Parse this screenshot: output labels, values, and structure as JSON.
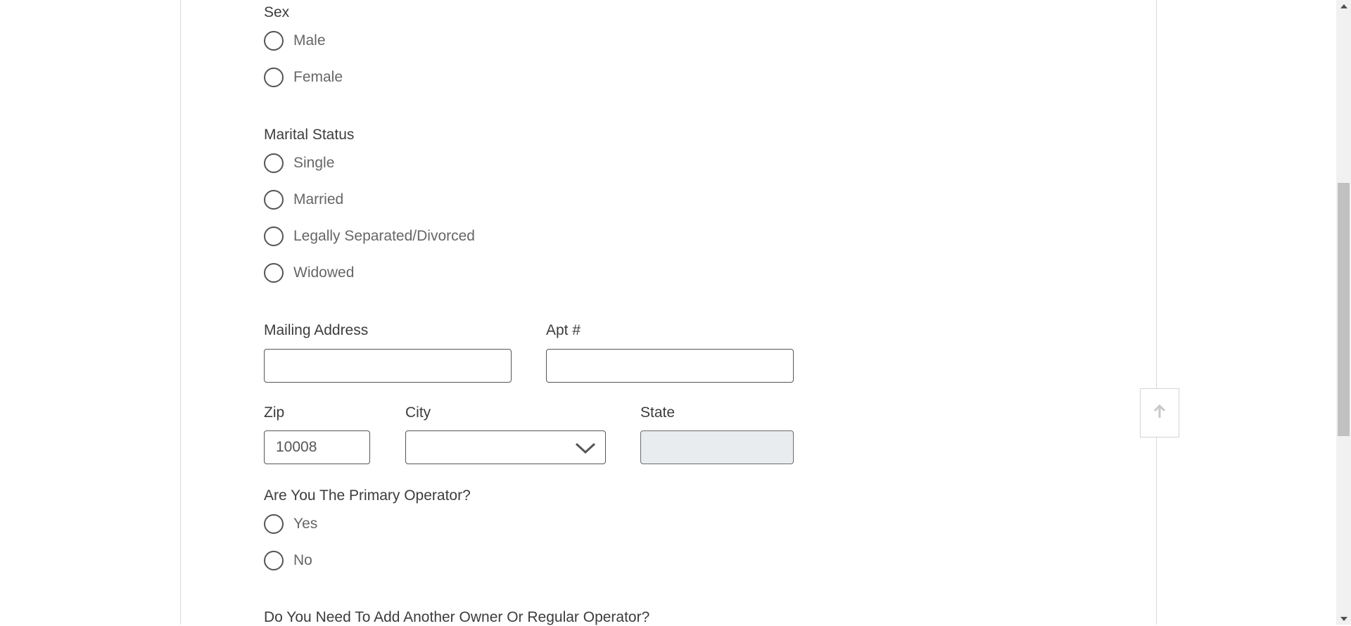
{
  "sex": {
    "label": "Sex",
    "options": [
      "Male",
      "Female"
    ]
  },
  "marital_status": {
    "label": "Marital Status",
    "options": [
      "Single",
      "Married",
      "Legally Separated/Divorced",
      "Widowed"
    ]
  },
  "address": {
    "mailing_label": "Mailing Address",
    "mailing_value": "",
    "apt_label": "Apt #",
    "apt_value": "",
    "zip_label": "Zip",
    "zip_value": "10008",
    "city_label": "City",
    "city_value": "",
    "state_label": "State",
    "state_value": ""
  },
  "primary_operator": {
    "label": "Are You The Primary Operator?",
    "options": [
      "Yes",
      "No"
    ]
  },
  "another_owner": {
    "label": "Do You Need To Add Another Owner Or Regular Operator?"
  },
  "icons": {
    "scroll_top": "arrow-up-icon",
    "city_dropdown": "chevron-down-icon"
  },
  "colors": {
    "text": "#3c3c3c",
    "radio_text": "#666666",
    "disabled_field": "#e9ecef",
    "border": "#555555"
  }
}
